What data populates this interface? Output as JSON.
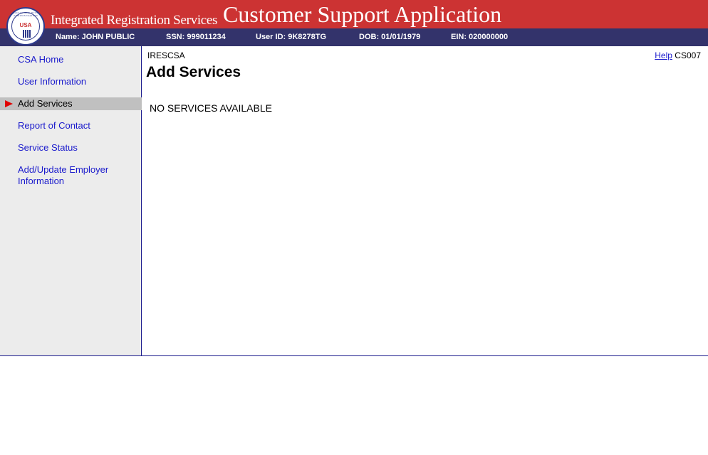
{
  "header": {
    "seal_text": "SOCIAL SECURITY ADMINISTRATION",
    "seal_usa": "USA",
    "subtitle": "Integrated Registration Services",
    "title": "Customer Support Application",
    "colors": {
      "banner": "#cc3333",
      "info_bar": "#33336b"
    }
  },
  "info_bar": {
    "name": "Name: JOHN PUBLIC",
    "ssn": "SSN: 999011234",
    "user_id": "User ID: 9K8278TG",
    "dob": "DOB: 01/01/1979",
    "ein": "EIN: 020000000"
  },
  "sidebar": {
    "items": [
      {
        "label": "CSA Home"
      },
      {
        "label": "User Information"
      },
      {
        "label": "Add Services",
        "active": true
      },
      {
        "label": "Report of Contact"
      },
      {
        "label": "Service Status"
      },
      {
        "label": "Add/Update Employer Information"
      }
    ],
    "active_marker_icon": "red-triangle-arrow-icon"
  },
  "main": {
    "app_code": "IRESCSA",
    "help_label": "Help",
    "screen_code": "CS007",
    "heading": "Add Services",
    "message": "NO SERVICES AVAILABLE"
  }
}
